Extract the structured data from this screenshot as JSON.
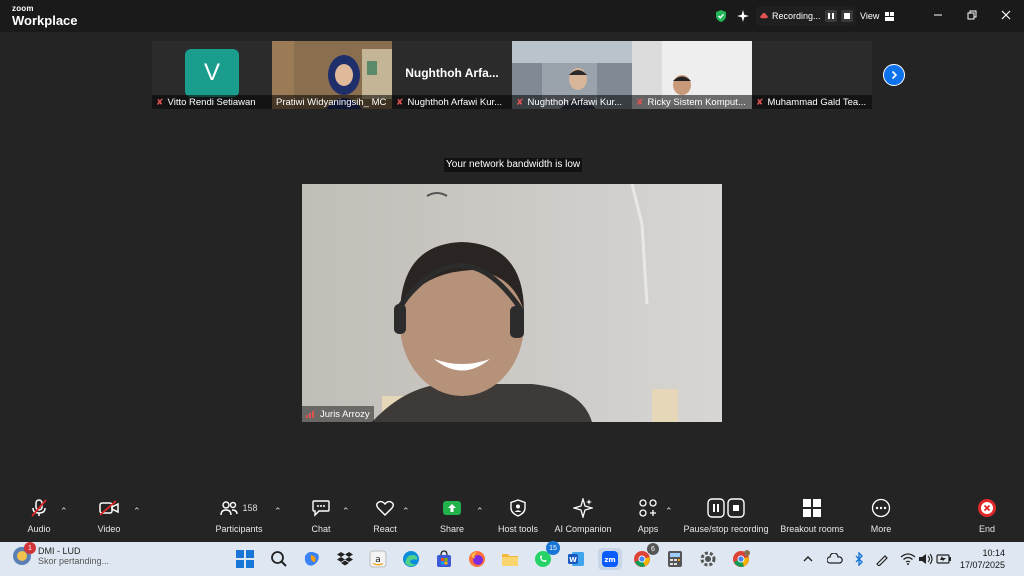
{
  "app": {
    "logo_top": "zoom",
    "logo_bottom": "Workplace"
  },
  "titlebar": {
    "recording_label": "Recording...",
    "view_label": "View",
    "icons": [
      "shield-check-icon",
      "sparkle-icon",
      "pause-icon",
      "stop-icon",
      "grid-icon",
      "minimize-icon",
      "restore-icon",
      "close-icon"
    ]
  },
  "participants_strip": [
    {
      "name": "Vitto Rendi Setiawan",
      "avatar_letter": "V",
      "muted": true
    },
    {
      "name": "Pratiwi Widyaningsih_ MC",
      "muted": false
    },
    {
      "name": "Nughthoh Arfawi Kur...",
      "display_name": "Nughthoh Arfa...",
      "muted": true
    },
    {
      "name": "Nughthoh Arfawi Kur...",
      "muted": true
    },
    {
      "name": "Ricky Sistem Komput...",
      "muted": true
    },
    {
      "name": "Muhammad Gald Tea...",
      "muted": true
    }
  ],
  "notice": "Your network bandwidth is low",
  "active_speaker": {
    "name": "Juris Arrozy"
  },
  "toolbar": {
    "audio": "Audio",
    "video": "Video",
    "participants": "Participants",
    "participants_count": "158",
    "chat": "Chat",
    "react": "React",
    "share": "Share",
    "host_tools": "Host tools",
    "ai_companion": "AI Companion",
    "apps": "Apps",
    "pause_stop_recording": "Pause/stop recording",
    "breakout_rooms": "Breakout rooms",
    "more": "More",
    "end": "End"
  },
  "taskbar": {
    "news_title": "DMI - LUD",
    "news_subtitle": "Skor pertanding...",
    "news_badge": "1",
    "whatsapp_badge": "15",
    "chrome_badge": "6",
    "time": "10:14",
    "date": "17/07/2025",
    "icons": [
      "windows-start-icon",
      "search-icon",
      "copilot-icon",
      "dropbox-icon",
      "amazon-icon",
      "edge-icon",
      "store-icon",
      "firefox-icon",
      "file-explorer-icon",
      "whatsapp-icon",
      "word-icon",
      "zoom-icon",
      "chrome-icon",
      "calculator-icon",
      "settings-icon",
      "chrome-profile-icon"
    ]
  },
  "colors": {
    "accent": "#0e72ed",
    "muted_red": "#e25252",
    "share_green": "#22b24c",
    "end_red": "#e02828"
  }
}
